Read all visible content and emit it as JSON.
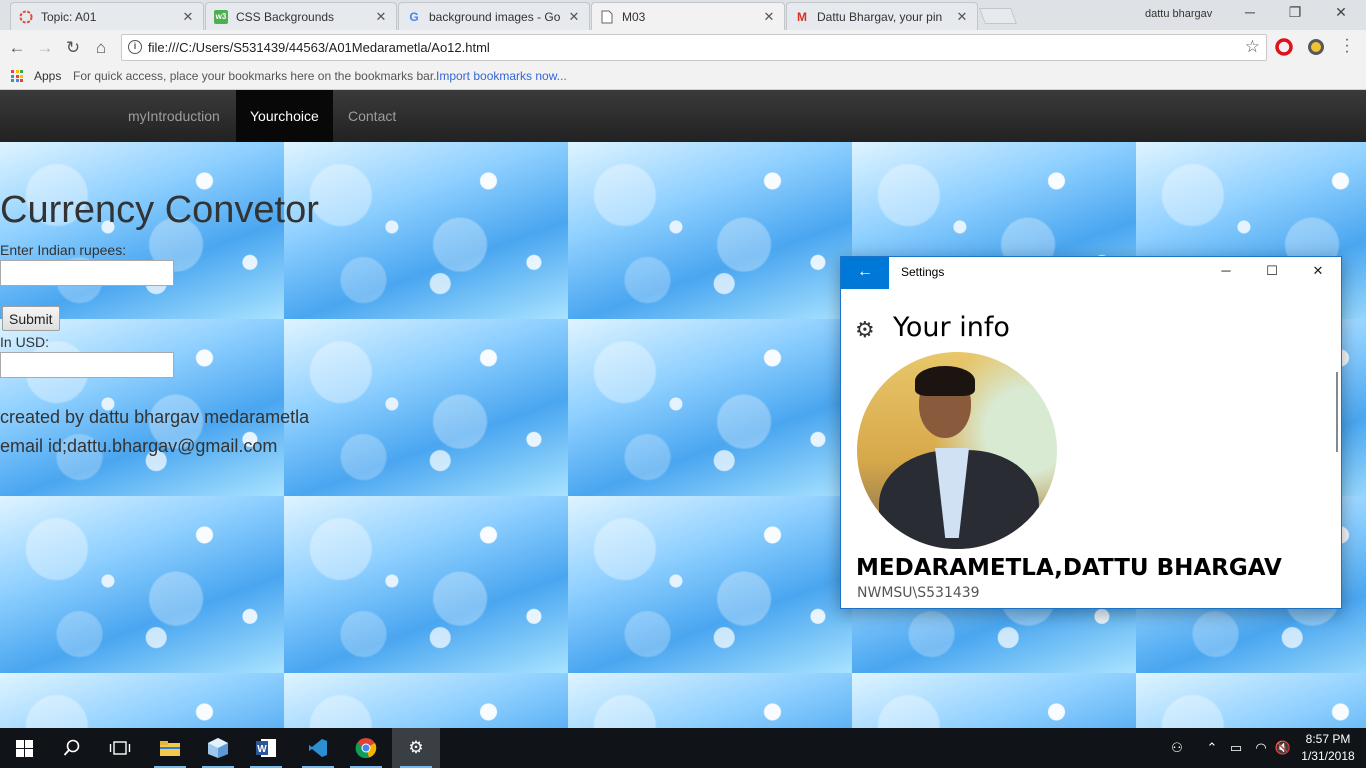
{
  "browser": {
    "tabs": [
      {
        "title": "Topic: A01",
        "icon": "d2l-icon",
        "active": false
      },
      {
        "title": "CSS Backgrounds",
        "icon": "w3schools-icon",
        "active": false
      },
      {
        "title": "background images - Go",
        "icon": "google-icon",
        "active": false
      },
      {
        "title": "M03",
        "icon": "page-icon",
        "active": true
      },
      {
        "title": "Dattu Bhargav, your pin",
        "icon": "gmail-icon",
        "active": false
      }
    ],
    "profile_name": "dattu bhargav",
    "url": "file:///C:/Users/S531439/44563/A01Medarametla/Ao12.html",
    "bookmarks": {
      "apps_label": "Apps",
      "hint": "For quick access, place your bookmarks here on the bookmarks bar.",
      "import_link": "Import bookmarks now..."
    }
  },
  "site": {
    "nav": [
      {
        "label": "myIntroduction",
        "active": false
      },
      {
        "label": "Yourchoice",
        "active": true
      },
      {
        "label": "Contact",
        "active": false
      }
    ],
    "converter": {
      "title": "Currency Convetor",
      "rupees_label": "Enter Indian rupees:",
      "rupees_value": "",
      "submit_label": "Submit",
      "usd_label": "In USD:",
      "usd_value": ""
    },
    "created_by": "created by dattu bhargav medarametla",
    "email": "email id;dattu.bhargav@gmail.com"
  },
  "settings_window": {
    "title": "Settings",
    "heading": "Your info",
    "name": "MEDARAMETLA,DATTU BHARGAV",
    "account": "NWMSU\\S531439"
  },
  "taskbar": {
    "time": "8:57 PM",
    "date": "1/31/2018"
  },
  "colors": {
    "accent_blue": "#0078d7",
    "nav_dark": "#222222",
    "taskbar": "#101418"
  }
}
